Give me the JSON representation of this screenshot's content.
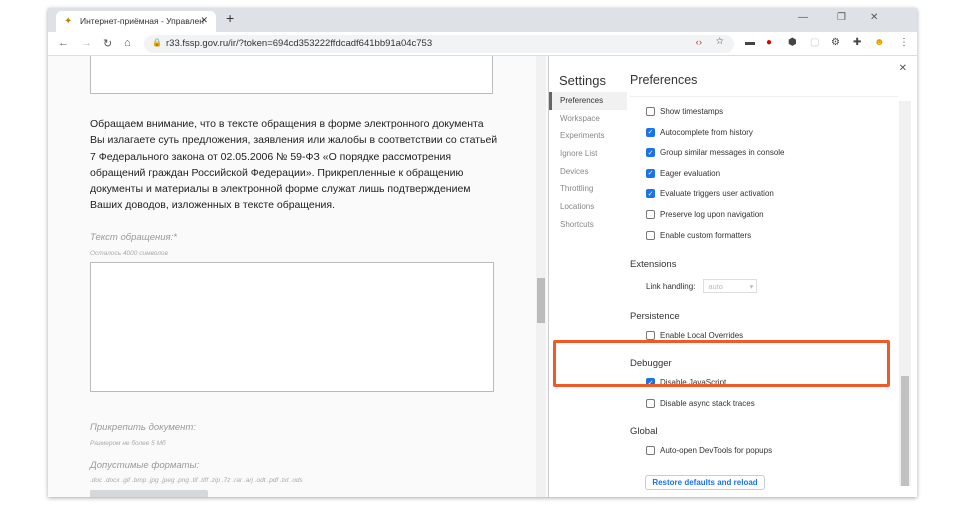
{
  "browser": {
    "tab_title": "Интернет-приёмная - Управлен",
    "url": "r33.fssp.gov.ru/ir/?token=694cd353222ffdcadf641bb91a04c753"
  },
  "page": {
    "notice": "Обращаем внимание, что в тексте обращения в форме электронного документа Вы излагаете суть предложения, заявления или жалобы в соответствии со статьей 7 Федерального закона от 02.05.2006 № 59-ФЗ «О порядке рассмотрения обращений граждан Российской Федерации». Прикрепленные к обращению документы и материалы в электронной форме служат лишь подтверждением Ваших доводов, изложенных в тексте обращения.",
    "text_label": "Текст обращения:*",
    "chars_left": "Осталось 4000 символов",
    "attach_label": "Прикрепить документ:",
    "attach_hint": "Размером не более 5 Мб",
    "formats_label": "Допустимые форматы:",
    "formats": ".doc .docx .gif .bmp .jpg .jpeg .png .tif .tiff .zip .7z .rar .arj .odt .pdf .txt .ods"
  },
  "devtools": {
    "settings_title": "Settings",
    "panel_title": "Preferences",
    "sidebar": [
      "Preferences",
      "Workspace",
      "Experiments",
      "Ignore List",
      "Devices",
      "Throttling",
      "Locations",
      "Shortcuts"
    ],
    "console_options": [
      {
        "label": "Show timestamps",
        "checked": false
      },
      {
        "label": "Autocomplete from history",
        "checked": true
      },
      {
        "label": "Group similar messages in console",
        "checked": true
      },
      {
        "label": "Eager evaluation",
        "checked": true
      },
      {
        "label": "Evaluate triggers user activation",
        "checked": true
      },
      {
        "label": "Preserve log upon navigation",
        "checked": false
      },
      {
        "label": "Enable custom formatters",
        "checked": false
      }
    ],
    "extensions": {
      "heading": "Extensions",
      "link_label": "Link handling:",
      "link_value": "auto"
    },
    "persistence": {
      "heading": "Persistence",
      "option": "Enable Local Overrides",
      "checked": false
    },
    "debugger": {
      "heading": "Debugger",
      "options": [
        {
          "label": "Disable JavaScript",
          "checked": true
        },
        {
          "label": "Disable async stack traces",
          "checked": false
        }
      ]
    },
    "global": {
      "heading": "Global",
      "option": "Auto-open DevTools for popups",
      "checked": false
    },
    "restore_label": "Restore defaults and reload"
  },
  "colors": {
    "highlight": "#f05a28",
    "accent": "#1a73e8"
  }
}
